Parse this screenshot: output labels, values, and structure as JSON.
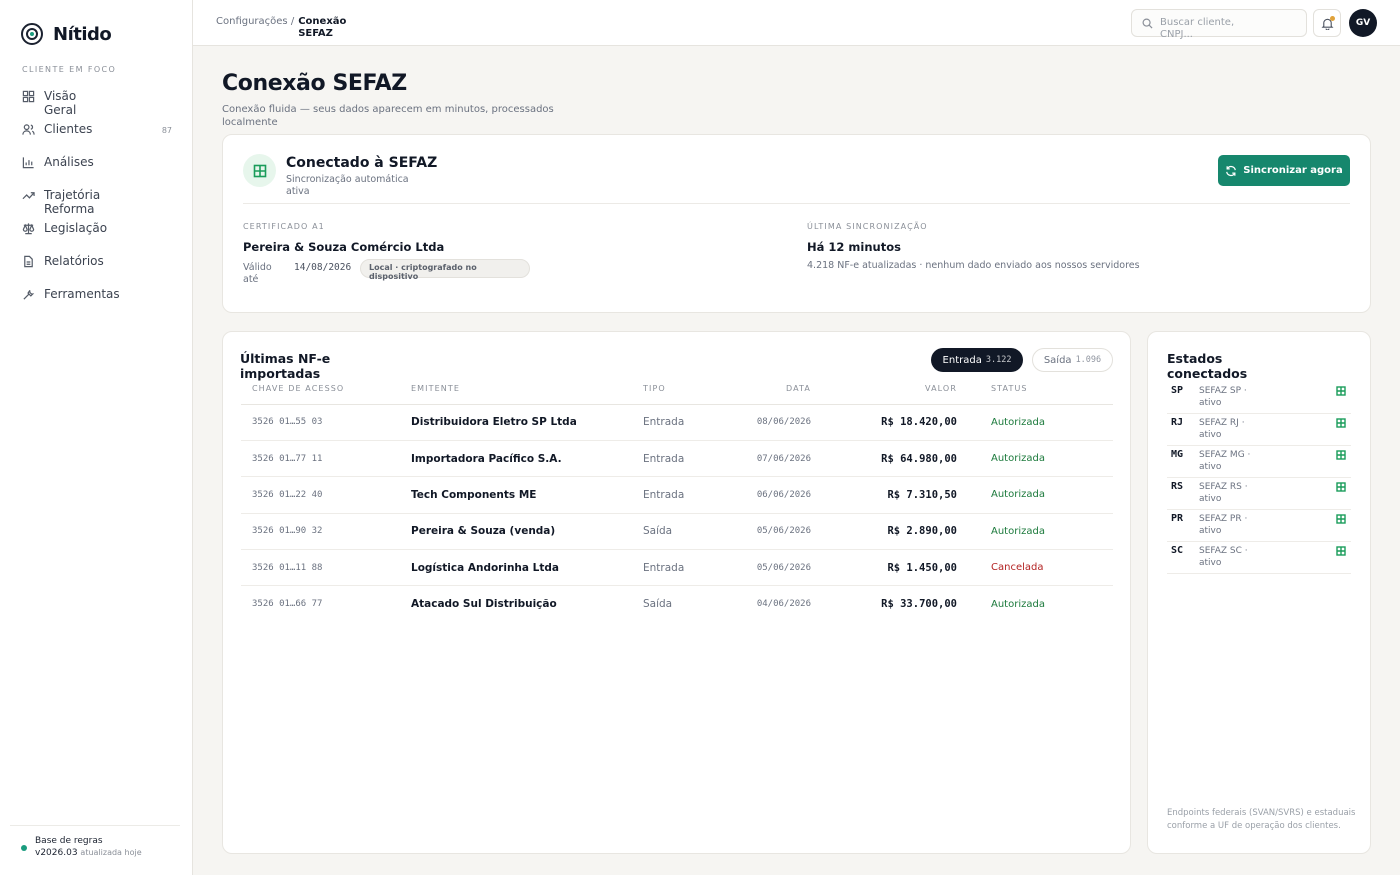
{
  "app": {
    "name": "Nítido"
  },
  "sidebar": {
    "section_label": "CLIENTE EM FOCO",
    "items": [
      {
        "label": "Visão Geral",
        "icon": "grid-icon"
      },
      {
        "label": "Clientes",
        "icon": "users-icon",
        "count": "87"
      },
      {
        "label": "Análises",
        "icon": "bar-chart-icon"
      },
      {
        "label": "Trajetória Reforma",
        "icon": "trend-icon"
      },
      {
        "label": "Legislação",
        "icon": "scale-icon"
      },
      {
        "label": "Relatórios",
        "icon": "file-icon"
      },
      {
        "label": "Ferramentas",
        "icon": "wrench-icon"
      }
    ],
    "footer": {
      "title": "Base de regras v2026.03",
      "status": "atualizada hoje"
    }
  },
  "topbar": {
    "breadcrumb_parent": "Configurações /",
    "breadcrumb_current": "Conexão SEFAZ",
    "search_placeholder": "Buscar cliente, CNPJ...",
    "avatar_initials": "GV"
  },
  "page": {
    "title": "Conexão SEFAZ",
    "subtitle": "Conexão fluida — seus dados aparecem em minutos, processados localmente"
  },
  "connection": {
    "title": "Conectado à SEFAZ",
    "subtitle": "Sincronização automática ativa",
    "sync_button": "Sincronizar agora",
    "cert_label": "CERTIFICADO A1",
    "cert_company": "Pereira & Souza Comércio Ltda",
    "valid_label": "Válido até",
    "valid_date": "14/08/2026",
    "storage_pill": "Local · criptografado no dispositivo",
    "last_sync_label": "ÚLTIMA SINCRONIZAÇÃO",
    "last_sync_value": "Há 12 minutos",
    "last_sync_meta": "4.218 NF-e atualizadas · nenhum dado enviado aos nossos servidores",
    "accent": "#16876d"
  },
  "nfe": {
    "title": "Últimas NF-e importadas",
    "tabs": [
      {
        "label": "Entrada",
        "count": "3.122",
        "active": true
      },
      {
        "label": "Saída",
        "count": "1.096",
        "active": false
      }
    ],
    "columns": [
      "CHAVE DE ACESSO",
      "EMITENTE",
      "TIPO",
      "DATA",
      "VALOR",
      "STATUS"
    ],
    "rows": [
      {
        "key": "3526 01…55 03",
        "emitter": "Distribuidora Eletro SP Ltda",
        "type": "Entrada",
        "date": "08/06/2026",
        "value": "R$ 18.420,00",
        "status": "Autorizada"
      },
      {
        "key": "3526 01…77 11",
        "emitter": "Importadora Pacífico S.A.",
        "type": "Entrada",
        "date": "07/06/2026",
        "value": "R$ 64.980,00",
        "status": "Autorizada"
      },
      {
        "key": "3526 01…22 40",
        "emitter": "Tech Components ME",
        "type": "Entrada",
        "date": "06/06/2026",
        "value": "R$ 7.310,50",
        "status": "Autorizada"
      },
      {
        "key": "3526 01…90 32",
        "emitter": "Pereira & Souza (venda)",
        "type": "Saída",
        "date": "05/06/2026",
        "value": "R$ 2.890,00",
        "status": "Autorizada"
      },
      {
        "key": "3526 01…11 88",
        "emitter": "Logística Andorinha Ltda",
        "type": "Entrada",
        "date": "05/06/2026",
        "value": "R$ 1.450,00",
        "status": "Cancelada"
      },
      {
        "key": "3526 01…66 77",
        "emitter": "Atacado Sul Distribuição",
        "type": "Saída",
        "date": "04/06/2026",
        "value": "R$ 33.700,00",
        "status": "Autorizada"
      }
    ],
    "status_colors": {
      "Autorizada": "#1c7a3c",
      "Cancelada": "#b32323"
    }
  },
  "states": {
    "title": "Estados conectados",
    "items": [
      {
        "uf": "SP",
        "name": "SEFAZ SP · ativo"
      },
      {
        "uf": "RJ",
        "name": "SEFAZ RJ · ativo"
      },
      {
        "uf": "MG",
        "name": "SEFAZ MG · ativo"
      },
      {
        "uf": "RS",
        "name": "SEFAZ RS · ativo"
      },
      {
        "uf": "PR",
        "name": "SEFAZ PR · ativo"
      },
      {
        "uf": "SC",
        "name": "SEFAZ SC · ativo"
      }
    ],
    "footnote": "Endpoints federais (SVAN/SVRS) e estaduais conforme a UF de operação dos clientes."
  }
}
